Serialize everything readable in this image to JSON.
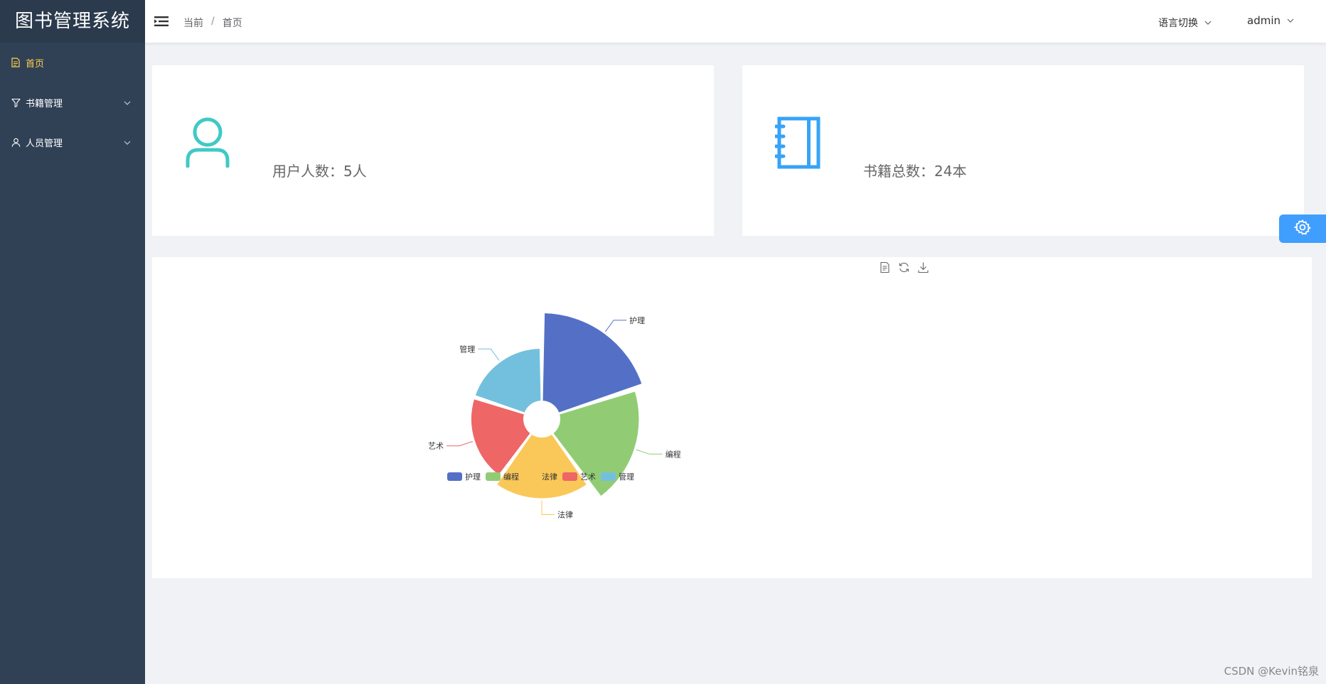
{
  "app": {
    "title": "图书管理系统"
  },
  "sidebar": {
    "items": [
      {
        "label": "首页",
        "icon": "document-icon",
        "active": true
      },
      {
        "label": "书籍管理",
        "icon": "filter-icon",
        "expandable": true
      },
      {
        "label": "人员管理",
        "icon": "user-icon",
        "expandable": true
      }
    ]
  },
  "header": {
    "breadcrumb": [
      "当前",
      "首页"
    ],
    "language_label": "语言切换",
    "user_label": "admin"
  },
  "stats": {
    "users_label": "用户人数：5人",
    "books_label": "书籍总数：24本"
  },
  "colors": {
    "accent": "#409eff",
    "sidebar_bg": "#304156",
    "active_menu": "#ffd04b",
    "user_icon": "#40c9c6",
    "book_icon": "#36a3f7"
  },
  "chart_data": {
    "type": "pie",
    "subtype": "rose",
    "categories": [
      "护理",
      "编程",
      "法律",
      "艺术",
      "管理"
    ],
    "values": [
      6,
      5.5,
      4.5,
      4,
      4
    ],
    "colors": [
      "#5470c6",
      "#91cc75",
      "#fac858",
      "#ee6666",
      "#73c0de"
    ],
    "legend": [
      "护理",
      "编程",
      "法律",
      "艺术",
      "管理"
    ],
    "legend_position": "bottom",
    "toolbox": [
      "data-view-icon",
      "restore-icon",
      "save-image-icon"
    ]
  },
  "watermark": "CSDN @Kevin铭泉"
}
